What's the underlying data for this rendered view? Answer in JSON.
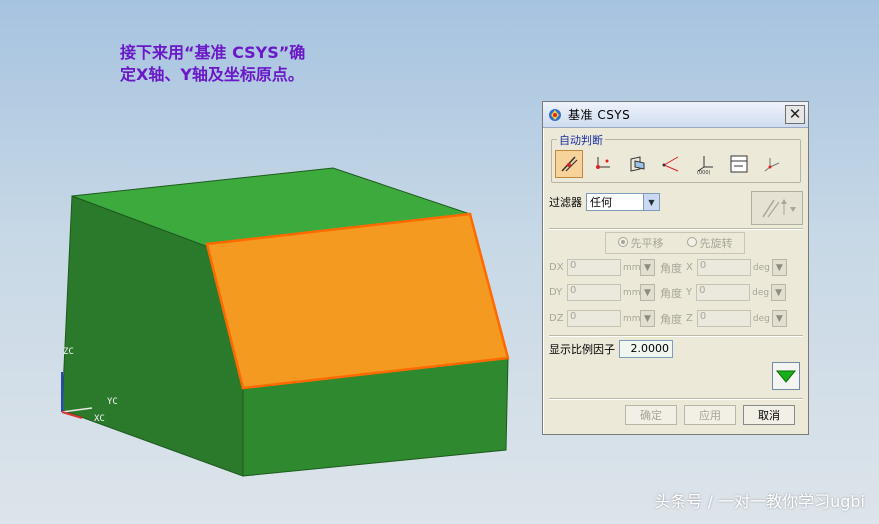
{
  "caption": {
    "line1": "接下来用“基准 CSYS”确",
    "line2": "定X轴、Y轴及坐标原点。"
  },
  "axes": {
    "zc": "ZC",
    "yc": "YC",
    "xc": "XC"
  },
  "watermark": "头条号 / 一对一教你学习ugbi",
  "colors": {
    "box_top": "#3aa83a",
    "box_side": "#2c7f2c",
    "box_front": "#2f8a2f",
    "highlight_face": "#f59a20",
    "highlight_edge": "#ff6a00",
    "caption": "#6a18c8"
  },
  "dialog": {
    "title": "基准 CSYS",
    "close_icon": "close-icon",
    "group_title": "自动判断",
    "type_icons": [
      "auto-infer-icon",
      "origin-x-y-icon",
      "three-planes-icon",
      "x-axis-y-axis-icon",
      "origin-offset-icon",
      "wcs-icon",
      "absolute-csys-icon"
    ],
    "filter_label": "过滤器",
    "filter_value": "任何",
    "radio_1": "先平移",
    "radio_2": "先旋转",
    "rows": [
      {
        "label": "DX",
        "value": "0",
        "unit": "mm",
        "angle_label": "角度",
        "axis": "X",
        "angle_value": "0",
        "angle_unit": "deg"
      },
      {
        "label": "DY",
        "value": "0",
        "unit": "mm",
        "angle_label": "角度",
        "axis": "Y",
        "angle_value": "0",
        "angle_unit": "deg"
      },
      {
        "label": "DZ",
        "value": "0",
        "unit": "mm",
        "angle_label": "角度",
        "axis": "Z",
        "angle_value": "0",
        "angle_unit": "deg"
      }
    ],
    "scale_label": "显示比例因子",
    "scale_value": "2.0000",
    "ok_label": "确定",
    "apply_label": "应用",
    "cancel_label": "取消"
  }
}
